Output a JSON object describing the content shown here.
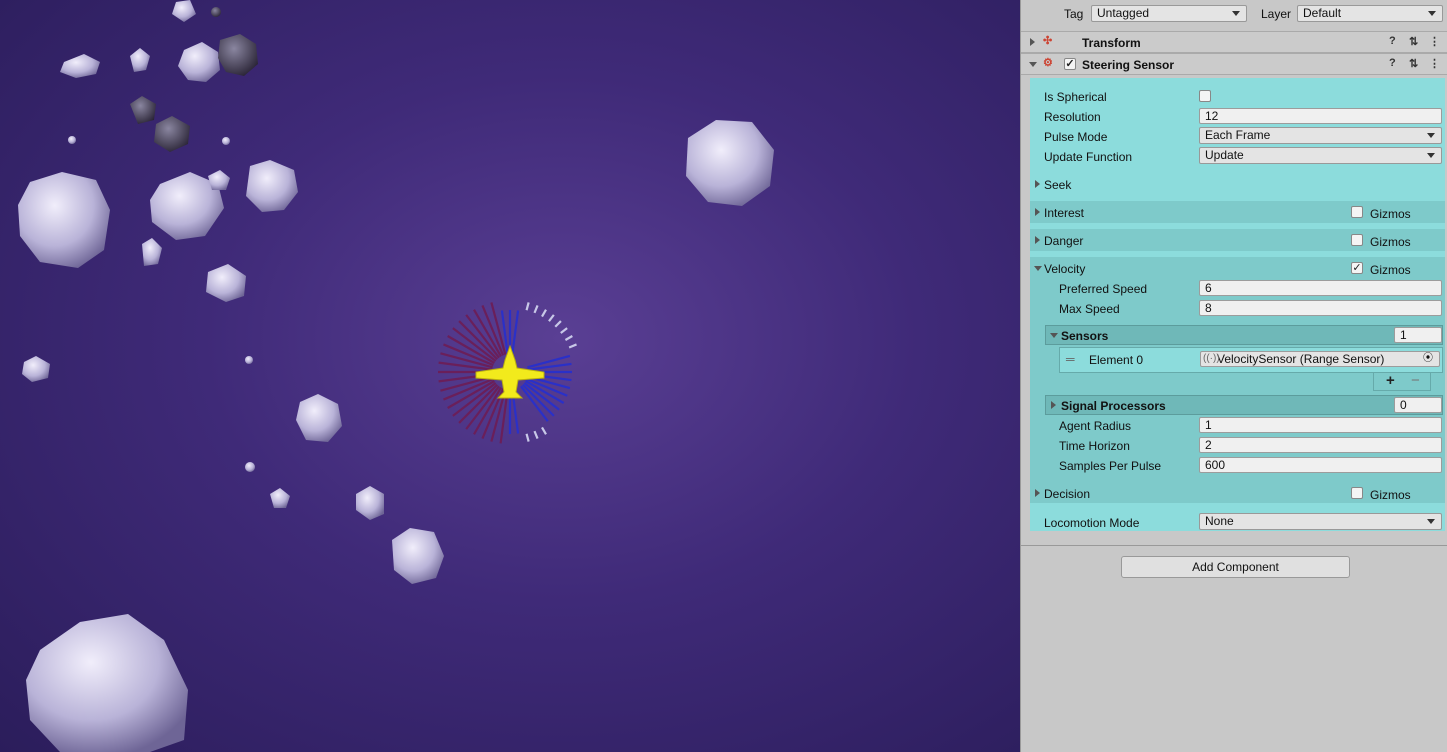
{
  "inspector": {
    "tag_label": "Tag",
    "tag_value": "Untagged",
    "layer_label": "Layer",
    "layer_value": "Default",
    "components": {
      "transform": {
        "title": "Transform"
      },
      "steering_sensor": {
        "title": "Steering Sensor",
        "enabled": true
      }
    },
    "fields": {
      "is_spherical": {
        "label": "Is Spherical",
        "checked": false
      },
      "resolution": {
        "label": "Resolution",
        "value": "12"
      },
      "pulse_mode": {
        "label": "Pulse Mode",
        "value": "Each Frame"
      },
      "update_function": {
        "label": "Update Function",
        "value": "Update"
      }
    },
    "sections": {
      "seek": {
        "label": "Seek"
      },
      "interest": {
        "label": "Interest",
        "gizmos_label": "Gizmos",
        "gizmos": false
      },
      "danger": {
        "label": "Danger",
        "gizmos_label": "Gizmos",
        "gizmos": false
      },
      "velocity": {
        "label": "Velocity",
        "gizmos_label": "Gizmos",
        "gizmos": true,
        "preferred_speed_label": "Preferred Speed",
        "preferred_speed": "6",
        "max_speed_label": "Max Speed",
        "max_speed": "8",
        "sensors_label": "Sensors",
        "sensors_count": "1",
        "element0_label": "Element 0",
        "element0_value": "VelocitySensor (Range Sensor)",
        "signal_processors_label": "Signal Processors",
        "signal_processors_count": "0",
        "agent_radius_label": "Agent Radius",
        "agent_radius": "1",
        "time_horizon_label": "Time Horizon",
        "time_horizon": "2",
        "samples_per_pulse_label": "Samples Per Pulse",
        "samples_per_pulse": "600"
      },
      "decision": {
        "label": "Decision",
        "gizmos_label": "Gizmos",
        "gizmos": false
      },
      "locomotion": {
        "label": "Locomotion Mode",
        "value": "None"
      }
    },
    "add_component_label": "Add Component",
    "plus_glyph": "+",
    "minus_glyph": "−",
    "check_glyph": "✓"
  },
  "scene": {
    "background_color": "#3f2a78",
    "ship_color": "#f2ea1c",
    "asteroid_color": "#d8d4ee"
  }
}
